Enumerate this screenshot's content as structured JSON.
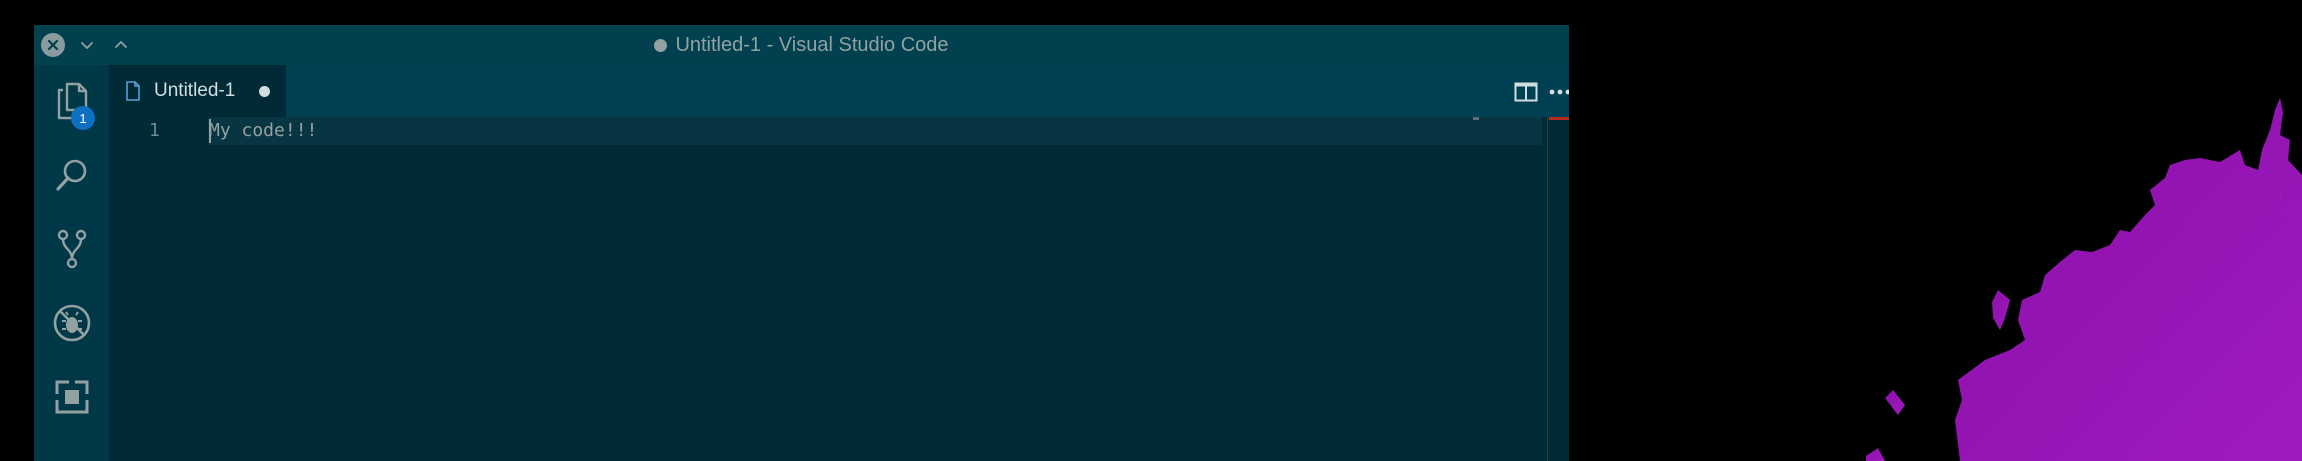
{
  "window": {
    "title": "Untitled-1 - Visual Studio Code",
    "title_dirty": true
  },
  "activity_bar": {
    "items": [
      {
        "name": "explorer",
        "icon": "files-icon",
        "badge": "1",
        "active": true
      },
      {
        "name": "search",
        "icon": "search-icon"
      },
      {
        "name": "source-control",
        "icon": "source-control-icon"
      },
      {
        "name": "debug",
        "icon": "debug-icon"
      },
      {
        "name": "extensions",
        "icon": "extensions-icon"
      }
    ]
  },
  "tabs": [
    {
      "label": "Untitled-1",
      "dirty": true,
      "icon": "file-icon",
      "active": true
    }
  ],
  "editor_actions": [
    {
      "name": "split-editor",
      "icon": "split-editor-icon"
    },
    {
      "name": "more-actions",
      "icon": "ellipsis-icon"
    }
  ],
  "editor": {
    "lines": [
      {
        "number": "1",
        "text": "My code!!!"
      }
    ]
  },
  "colors": {
    "titlebar": "#00404f",
    "activity_bar": "#003847",
    "editor_background": "#002b36",
    "current_line": "#073642",
    "text": "#93a1a1",
    "badge": "#0e70c0",
    "wallpaper_accent": "#9b14b8"
  }
}
